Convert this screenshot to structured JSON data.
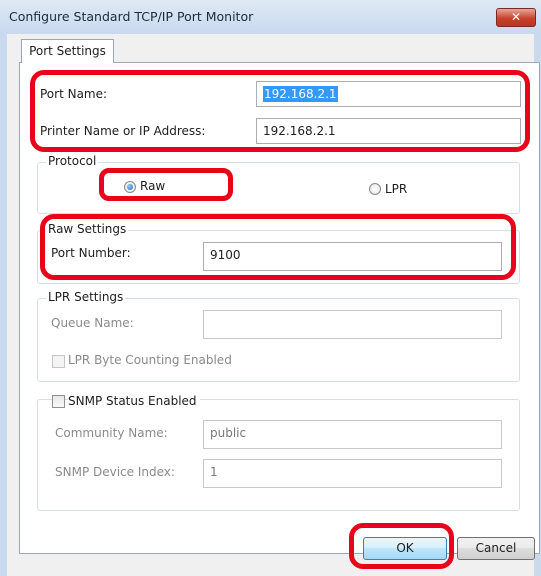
{
  "window": {
    "title": "Configure Standard TCP/IP Port Monitor",
    "close_label": "✕"
  },
  "tab": {
    "label": "Port Settings"
  },
  "port": {
    "name_label": "Port Name:",
    "name_value": "192.168.2.1",
    "printer_label": "Printer Name or IP Address:",
    "printer_value": "192.168.2.1"
  },
  "protocol": {
    "title": "Protocol",
    "raw_label": "Raw",
    "lpr_label": "LPR",
    "selected": "Raw"
  },
  "raw_settings": {
    "title": "Raw Settings",
    "port_label": "Port Number:",
    "port_value": "9100"
  },
  "lpr_settings": {
    "title": "LPR Settings",
    "queue_label": "Queue Name:",
    "queue_value": "",
    "byte_counting_label": "LPR Byte Counting Enabled"
  },
  "snmp": {
    "enabled_label": "SNMP Status Enabled",
    "community_label": "Community Name:",
    "community_value": "public",
    "device_index_label": "SNMP Device Index:",
    "device_index_value": "1"
  },
  "buttons": {
    "ok": "OK",
    "cancel": "Cancel"
  },
  "colors": {
    "highlight": "#e8051b",
    "selection": "#3399ff"
  }
}
